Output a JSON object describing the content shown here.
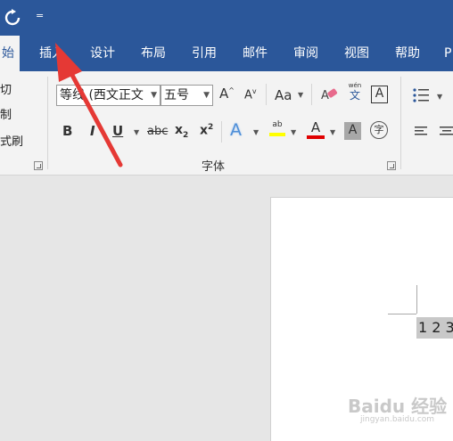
{
  "quick_access": {
    "redo_icon": "refresh-icon",
    "customize_glyph": "="
  },
  "tabs": [
    {
      "label": "开始",
      "visible": "始"
    },
    {
      "label": "插入"
    },
    {
      "label": "设计"
    },
    {
      "label": "布局"
    },
    {
      "label": "引用"
    },
    {
      "label": "邮件"
    },
    {
      "label": "审阅"
    },
    {
      "label": "视图"
    },
    {
      "label": "帮助"
    },
    {
      "label": "P"
    }
  ],
  "clipboard": {
    "cut": "剪切",
    "copy": "复制",
    "format_painter": "格式刷",
    "visible_cut": "剪切",
    "visible_copy": "复制",
    "visible_format": "式刷"
  },
  "font": {
    "family": "等线 (西文正文",
    "size": "五号",
    "group_label": "字体"
  },
  "font_buttons": {
    "bold": "B",
    "italic": "I",
    "underline": "U",
    "strikethrough": "abc",
    "subscript": "x",
    "subscript_mark": "2",
    "superscript": "x",
    "superscript_mark": "2",
    "grow": "A",
    "shrink": "A",
    "change_case": "Aa",
    "phonetic": "wén",
    "phonetic_char": "文",
    "char_border": "A",
    "text_effects": "A",
    "highlight": "ab",
    "font_color": "A",
    "char_shading": "A",
    "enclose": "字"
  },
  "document": {
    "selected_text": "1 2 3"
  },
  "watermark": {
    "text": "Baidu 经验",
    "sub": "jingyan.baidu.com"
  },
  "colors": {
    "accent": "#2b579a",
    "highlight": "#ffff00",
    "font_color": "#e00000",
    "arrow": "#e53935"
  }
}
